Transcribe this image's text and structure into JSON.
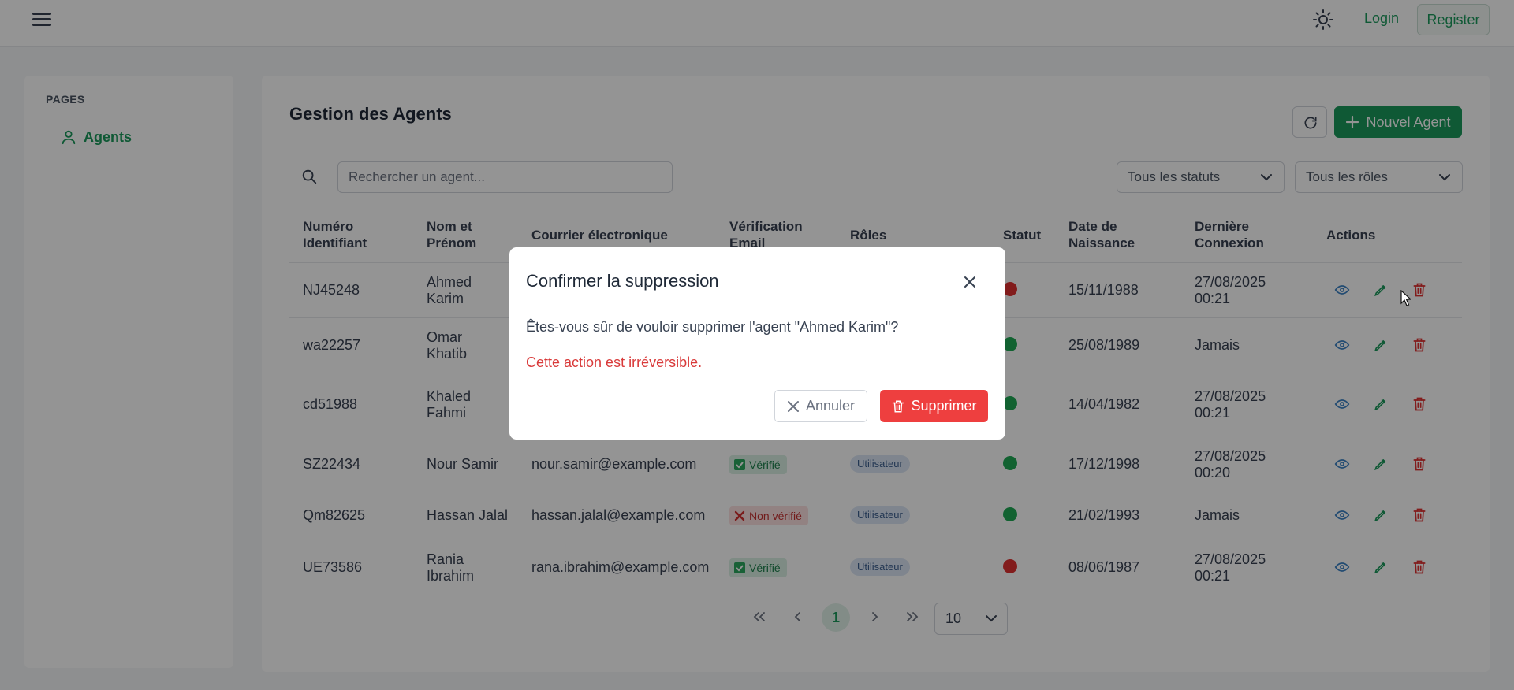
{
  "topbar": {
    "login": "Login",
    "register": "Register"
  },
  "sidebar": {
    "heading": "PAGES",
    "items": [
      {
        "label": "Agents",
        "icon": "user-icon",
        "active": true
      }
    ]
  },
  "main": {
    "title": "Gestion des Agents",
    "new_button": "Nouvel Agent",
    "search_placeholder": "Rechercher un agent...",
    "status_filter": "Tous les statuts",
    "roles_filter": "Tous les rôles",
    "columns": [
      {
        "line1": "Numéro",
        "line2": "Identifiant"
      },
      {
        "line1": "Nom et",
        "line2": "Prénom"
      },
      {
        "line1": "Courrier électronique",
        "line2": ""
      },
      {
        "line1": "Vérification",
        "line2": "Email"
      },
      {
        "line1": "Rôles",
        "line2": ""
      },
      {
        "line1": "Statut",
        "line2": ""
      },
      {
        "line1": "Date de",
        "line2": "Naissance"
      },
      {
        "line1": "Dernière",
        "line2": "Connexion"
      },
      {
        "line1": "Actions",
        "line2": ""
      }
    ],
    "rows": [
      {
        "id": "NJ45248",
        "name1": "Ahmed",
        "name2": "Karim",
        "email": "",
        "verified": null,
        "verified_label": "",
        "role": "",
        "status": "inactive",
        "birth": "15/11/1988",
        "last1": "27/08/2025",
        "last2": "00:21"
      },
      {
        "id": "wa22257",
        "name1": "Omar",
        "name2": "Khatib",
        "email": "",
        "verified": null,
        "verified_label": "",
        "role": "",
        "status": "active",
        "birth": "25/08/1989",
        "last1": "Jamais",
        "last2": ""
      },
      {
        "id": "cd51988",
        "name1": "Khaled",
        "name2": "Fahmi",
        "email": "",
        "verified": null,
        "verified_label": "",
        "role": "",
        "status": "active",
        "birth": "14/04/1982",
        "last1": "27/08/2025",
        "last2": "00:21"
      },
      {
        "id": "SZ22434",
        "name1": "Nour Samir",
        "name2": "",
        "email": "nour.samir@example.com",
        "verified": true,
        "verified_label": "Vérifié",
        "role": "Utilisateur",
        "status": "active",
        "birth": "17/12/1998",
        "last1": "27/08/2025",
        "last2": "00:20"
      },
      {
        "id": "Qm82625",
        "name1": "Hassan Jalal",
        "name2": "",
        "email": "hassan.jalal@example.com",
        "verified": false,
        "verified_label": "Non vérifié",
        "role": "Utilisateur",
        "status": "active",
        "birth": "21/02/1993",
        "last1": "Jamais",
        "last2": ""
      },
      {
        "id": "UE73586",
        "name1": "Rania",
        "name2": "Ibrahim",
        "email": "rana.ibrahim@example.com",
        "verified": true,
        "verified_label": "Vérifié",
        "role": "Utilisateur",
        "status": "inactive",
        "birth": "08/06/1987",
        "last1": "27/08/2025",
        "last2": "00:21"
      }
    ],
    "pagination": {
      "current_page": "1",
      "page_size": "10"
    }
  },
  "modal": {
    "title": "Confirmer la suppression",
    "message": "Êtes-vous sûr de vouloir supprimer l'agent \"Ahmed Karim\"?",
    "warning": "Cette action est irréversible.",
    "cancel": "Annuler",
    "confirm": "Supprimer"
  },
  "colors": {
    "primary": "#1a9a5c",
    "danger": "#ee3f3f",
    "status_active": "#1faa55",
    "status_inactive": "#e03131",
    "view_icon": "#3b82c4",
    "edit_icon": "#1a9a5c",
    "delete_icon": "#e03131"
  }
}
